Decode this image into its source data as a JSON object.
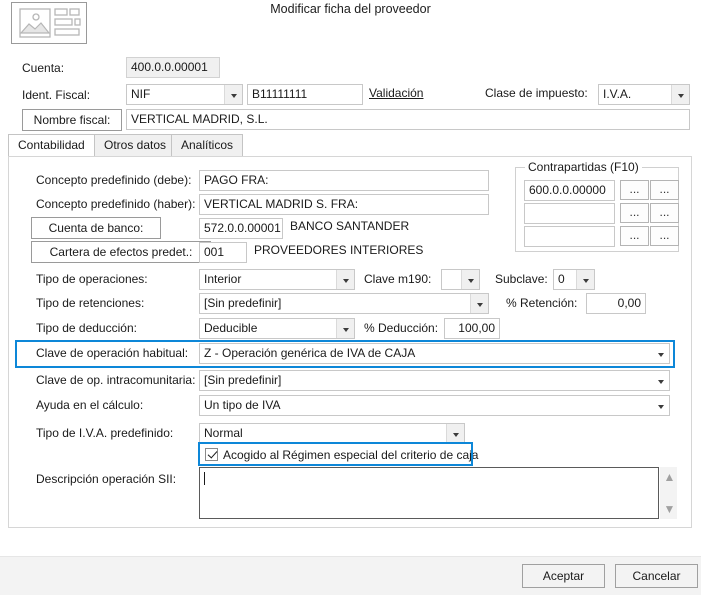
{
  "window": {
    "title": "Modificar ficha del proveedor",
    "icon": "record-card-icon"
  },
  "header_fields": {
    "cuenta_label": "Cuenta:",
    "cuenta_value": "400.0.0.00001",
    "ident_fiscal_label": "Ident. Fiscal:",
    "ident_fiscal_type": "NIF",
    "ident_fiscal_number": "B11111111",
    "validacion_link": "Validación",
    "clase_impuesto_label": "Clase de impuesto:",
    "clase_impuesto_value": "I.V.A.",
    "nombre_fiscal_label": "Nombre fiscal:",
    "nombre_fiscal_value": "VERTICAL MADRID, S.L."
  },
  "tabs": [
    {
      "label": "Contabilidad",
      "active": true
    },
    {
      "label": "Otros datos",
      "active": false
    },
    {
      "label": "Analíticos",
      "active": false
    }
  ],
  "contabilidad": {
    "concepto_debe_label": "Concepto predefinido (debe):",
    "concepto_debe_value": "PAGO FRA:",
    "concepto_haber_label": "Concepto predefinido (haber):",
    "concepto_haber_value": "VERTICAL MADRID S. FRA:",
    "cuenta_banco_label": "Cuenta de banco:",
    "cuenta_banco_value": "572.0.0.00001",
    "cuenta_banco_desc": "BANCO SANTANDER",
    "cartera_label": "Cartera de efectos predet.:",
    "cartera_value": "001",
    "cartera_desc": "PROVEEDORES INTERIORES",
    "contrapartidas": {
      "title": "Contrapartidas (F10)",
      "rows": [
        {
          "value": "600.0.0.00000",
          "btn1": "...",
          "btn2": "..."
        },
        {
          "value": "",
          "btn1": "...",
          "btn2": "..."
        },
        {
          "value": "",
          "btn1": "...",
          "btn2": "..."
        }
      ]
    },
    "tipo_operaciones_label": "Tipo de operaciones:",
    "tipo_operaciones_value": "Interior",
    "clave_m190_label": "Clave m190:",
    "clave_m190_value": "",
    "subclave_label": "Subclave:",
    "subclave_value": "0",
    "tipo_retenciones_label": "Tipo de retenciones:",
    "tipo_retenciones_value": "[Sin predefinir]",
    "pct_retencion_label": "% Retención:",
    "pct_retencion_value": "0,00",
    "tipo_deduccion_label": "Tipo de deducción:",
    "tipo_deduccion_value": "Deducible",
    "pct_deduccion_label": "% Deducción:",
    "pct_deduccion_value": "100,00",
    "clave_op_habitual_label": "Clave de operación habitual:",
    "clave_op_habitual_value": "Z - Operación genérica de IVA de CAJA",
    "clave_op_intra_label": "Clave de op. intracomunitaria:",
    "clave_op_intra_value": "[Sin predefinir]",
    "ayuda_calculo_label": "Ayuda en el cálculo:",
    "ayuda_calculo_value": "Un tipo de IVA",
    "tipo_iva_label": "Tipo de I.V.A. predefinido:",
    "tipo_iva_value": "Normal",
    "criterio_caja_label": "Acogido al Régimen especial del criterio de caja",
    "criterio_caja_checked": true,
    "descripcion_sii_label": "Descripción operación SII:",
    "descripcion_sii_value": ""
  },
  "footer": {
    "accept_label": "Aceptar",
    "cancel_label": "Cancelar"
  },
  "colors": {
    "highlight": "#0d87d8",
    "dialog_bg": "#ffffff",
    "footer_bg": "#f3f3f3",
    "readonly_field_bg": "#f0f0f0"
  }
}
